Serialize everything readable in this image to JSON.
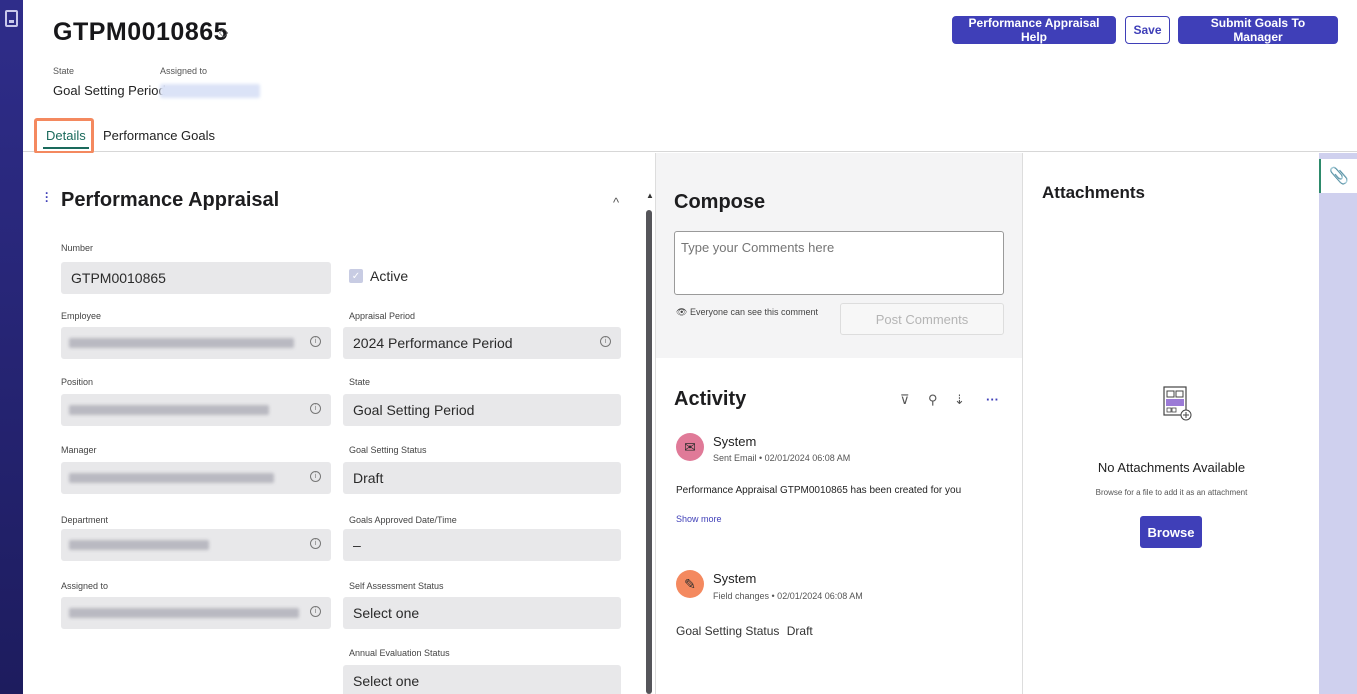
{
  "record": {
    "number": "GTPM0010865",
    "state_label": "State",
    "state_value": "Goal Setting Period",
    "assigned_label": "Assigned to"
  },
  "header_buttons": {
    "help": "Performance Appraisal Help",
    "save": "Save",
    "submit": "Submit Goals To Manager"
  },
  "tabs": [
    {
      "label": "Details",
      "active": true
    },
    {
      "label": "Performance Goals",
      "active": false
    }
  ],
  "form": {
    "title": "Performance Appraisal",
    "collapse_glyph": "^",
    "left_fields": [
      {
        "label": "Number",
        "value": "GTPM0010865"
      },
      {
        "label": "Employee",
        "value": ""
      },
      {
        "label": "Position",
        "value": ""
      },
      {
        "label": "Manager",
        "value": ""
      },
      {
        "label": "Department",
        "value": ""
      },
      {
        "label": "Assigned to",
        "value": ""
      }
    ],
    "active_label": "Active",
    "right_fields": [
      {
        "label": "Appraisal Period",
        "value": "2024 Performance Period"
      },
      {
        "label": "State",
        "value": "Goal Setting Period"
      },
      {
        "label": "Goal Setting Status",
        "value": "Draft"
      },
      {
        "label": "Goals Approved Date/Time",
        "value": "–"
      },
      {
        "label": "Self Assessment Status",
        "value": "Select one"
      },
      {
        "label": "Annual Evaluation Status",
        "value": "Select one"
      }
    ]
  },
  "compose": {
    "title": "Compose",
    "placeholder": "Type your Comments here",
    "visibility_note": "Everyone can see this comment",
    "post_label": "Post Comments"
  },
  "activity": {
    "title": "Activity",
    "entries": [
      {
        "author": "System",
        "meta": "Sent Email • 02/01/2024 06:08 AM",
        "text": "Performance Appraisal GTPM0010865 has been created for you",
        "show_more": "Show more",
        "icon": "email-icon",
        "color": "#e07a98"
      },
      {
        "author": "System",
        "meta": "Field changes • 02/01/2024 06:08 AM",
        "field_name": "Goal Setting Status",
        "field_value": "Draft",
        "icon": "edit-icon",
        "color": "#f4895f"
      }
    ]
  },
  "attachments": {
    "title": "Attachments",
    "empty_title": "No Attachments Available",
    "empty_sub": "Browse for a file to add it as an attachment",
    "browse_label": "Browse"
  },
  "colors": {
    "accent": "#3f3fb8",
    "tab_active": "#1a6a5c",
    "highlight": "#f4895f",
    "sidebar": "#2f2d8a"
  }
}
